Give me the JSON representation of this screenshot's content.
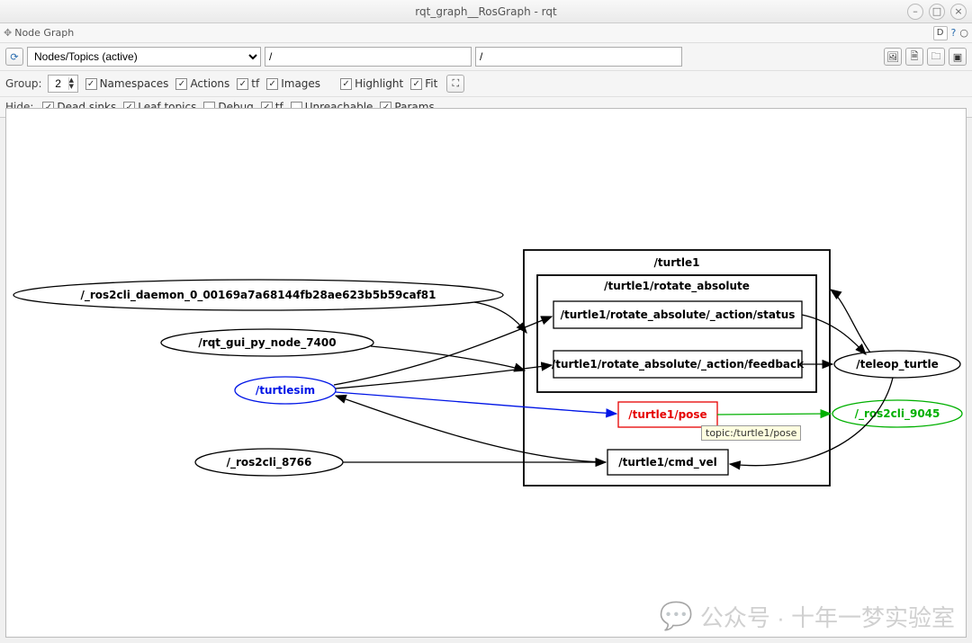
{
  "window": {
    "title": "rqt_graph__RosGraph - rqt"
  },
  "panel": {
    "title": "Node Graph",
    "d_button": "D"
  },
  "toolbar": {
    "mode_options": [
      "Nodes/Topics (active)"
    ],
    "mode_selected": "Nodes/Topics (active)",
    "filter1": "/",
    "filter2": "/"
  },
  "row2": {
    "group_label": "Group:",
    "group_value": "2",
    "namespaces_label": "Namespaces",
    "actions_label": "Actions",
    "tf_label": "tf",
    "images_label": "Images",
    "highlight_label": "Highlight",
    "fit_label": "Fit"
  },
  "row3": {
    "hide_label": "Hide:",
    "dead_sinks_label": "Dead sinks",
    "leaf_topics_label": "Leaf topics",
    "debug_label": "Debug",
    "tf_label": "tf",
    "unreachable_label": "Unreachable",
    "params_label": "Params"
  },
  "graph": {
    "nodes": {
      "daemon": "/_ros2cli_daemon_0_00169a7a68144fb28ae623b5b59caf81",
      "rqt_gui": "/rqt_gui_py_node_7400",
      "turtlesim": "/turtlesim",
      "ros2cli_8766": "/_ros2cli_8766",
      "teleop": "/teleop_turtle",
      "ros2cli_9045": "/_ros2cli_9045"
    },
    "groups": {
      "turtle1": "/turtle1",
      "rotate_abs": "/turtle1/rotate_absolute"
    },
    "topics": {
      "status": "/turtle1/rotate_absolute/_action/status",
      "feedback": "/turtle1/rotate_absolute/_action/feedback",
      "pose": "/turtle1/pose",
      "cmd_vel": "/turtle1/cmd_vel"
    },
    "tooltip": "topic:/turtle1/pose"
  },
  "watermark": {
    "text": "公众号 · 十年一梦实验室"
  }
}
